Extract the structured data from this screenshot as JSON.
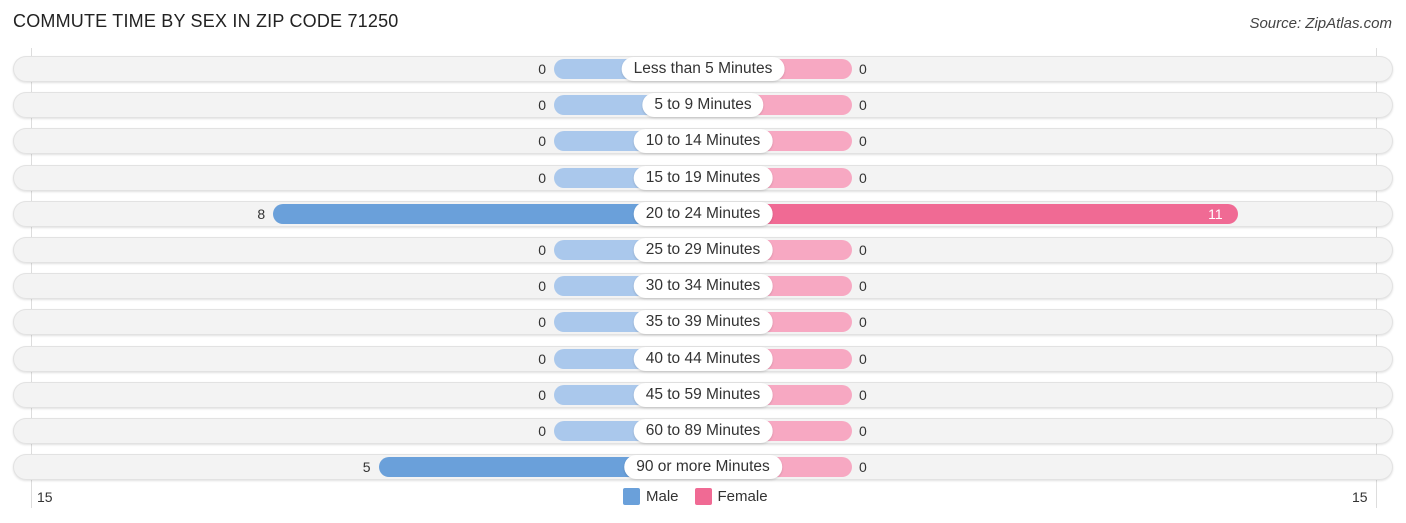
{
  "chart_data": {
    "type": "bar",
    "orientation": "horizontal-diverging",
    "title": "COMMUTE TIME BY SEX IN ZIP CODE 71250",
    "source": "Source: ZipAtlas.com",
    "categories": [
      "Less than 5 Minutes",
      "5 to 9 Minutes",
      "10 to 14 Minutes",
      "15 to 19 Minutes",
      "20 to 24 Minutes",
      "25 to 29 Minutes",
      "30 to 34 Minutes",
      "35 to 39 Minutes",
      "40 to 44 Minutes",
      "45 to 59 Minutes",
      "60 to 89 Minutes",
      "90 or more Minutes"
    ],
    "series": [
      {
        "name": "Male",
        "color": "#6aa0da",
        "light_color": "#aac8ec",
        "values": [
          0,
          0,
          0,
          0,
          8,
          0,
          0,
          0,
          0,
          0,
          0,
          5
        ]
      },
      {
        "name": "Female",
        "color": "#f06a94",
        "light_color": "#f7a8c2",
        "values": [
          0,
          0,
          0,
          0,
          11,
          0,
          0,
          0,
          0,
          0,
          0,
          0
        ]
      }
    ],
    "axis": {
      "left_label": "15",
      "right_label": "15",
      "range": [
        -15,
        15
      ]
    },
    "legend": {
      "position": "bottom-center",
      "items": [
        "Male",
        "Female"
      ]
    }
  }
}
